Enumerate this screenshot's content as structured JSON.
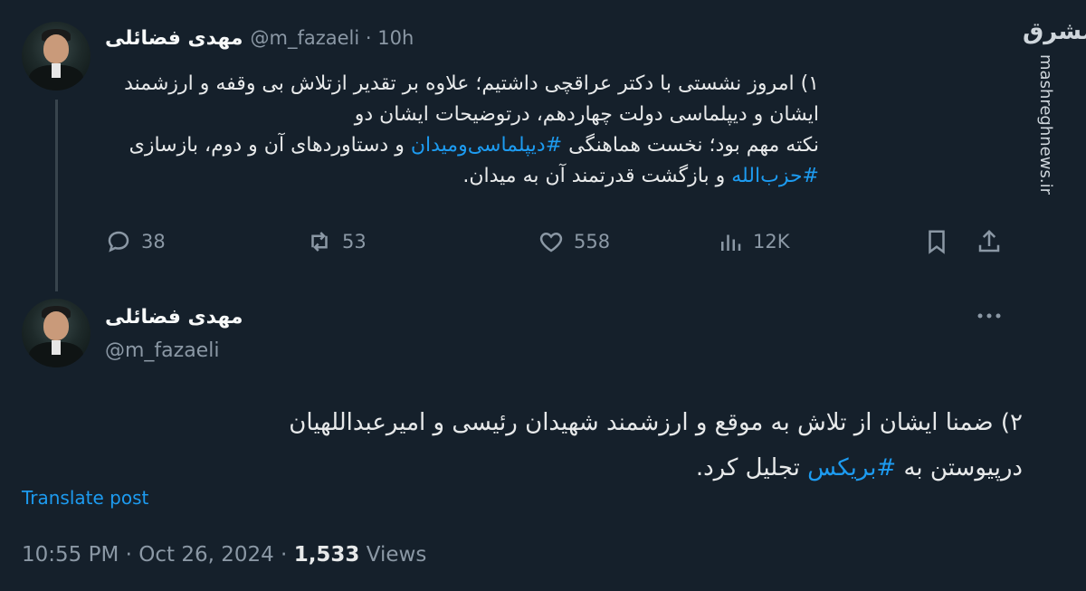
{
  "tweet1": {
    "author_name": "مهدی فضائلی",
    "handle_line": "@m_fazaeli · 10h",
    "text": {
      "line1": "۱) امروز نشستی با دکتر عراقچی داشتیم؛ علاوه بر تقدیر ازتلاش بی وقفه و ارزشمند",
      "line2": "ایشان و دیپلماسی دولت چهاردهم، درتوضیحات ایشان دو",
      "line3_before": "نکته مهم بود؛ نخست هماهنگی ",
      "line3_hashtag": "#دیپلماسی‌ومیدان",
      "line3_after": " و دستاوردهای آن و دوم، بازسازی",
      "line4_hashtag": "#حزب‌الله",
      "line4_after": " و بازگشت قدرتمند آن به میدان."
    },
    "actions": {
      "replies": "38",
      "reposts": "53",
      "likes": "558",
      "views": "12K"
    }
  },
  "tweet2": {
    "author_name": "مهدی فضائلی",
    "handle": "@m_fazaeli",
    "text": {
      "line1": "۲) ضمنا ایشان از تلاش به موقع و ارزشمند شهیدان رئیسی و امیرعبداللهیان",
      "line2_before": "درپیوستن به ",
      "line2_hashtag": "#بریکس",
      "line2_after": " تجلیل کرد."
    },
    "translate_label": "Translate post",
    "meta": {
      "time": "10:55 PM · Oct 26, 2024 · ",
      "views_count": "1,533",
      "views_label": " Views"
    }
  },
  "watermark": {
    "site": "mashreghnews.ir",
    "logo_text": "مشرق"
  },
  "icons": {
    "reply": "reply-icon",
    "repost": "repost-icon",
    "like": "heart-icon",
    "views": "views-icon",
    "bookmark": "bookmark-icon",
    "share": "share-icon",
    "more": "more-icon"
  },
  "colors": {
    "background": "#15202b",
    "accent": "#1d9bf0",
    "muted": "#8b98a5",
    "text": "#e7e9ea"
  }
}
